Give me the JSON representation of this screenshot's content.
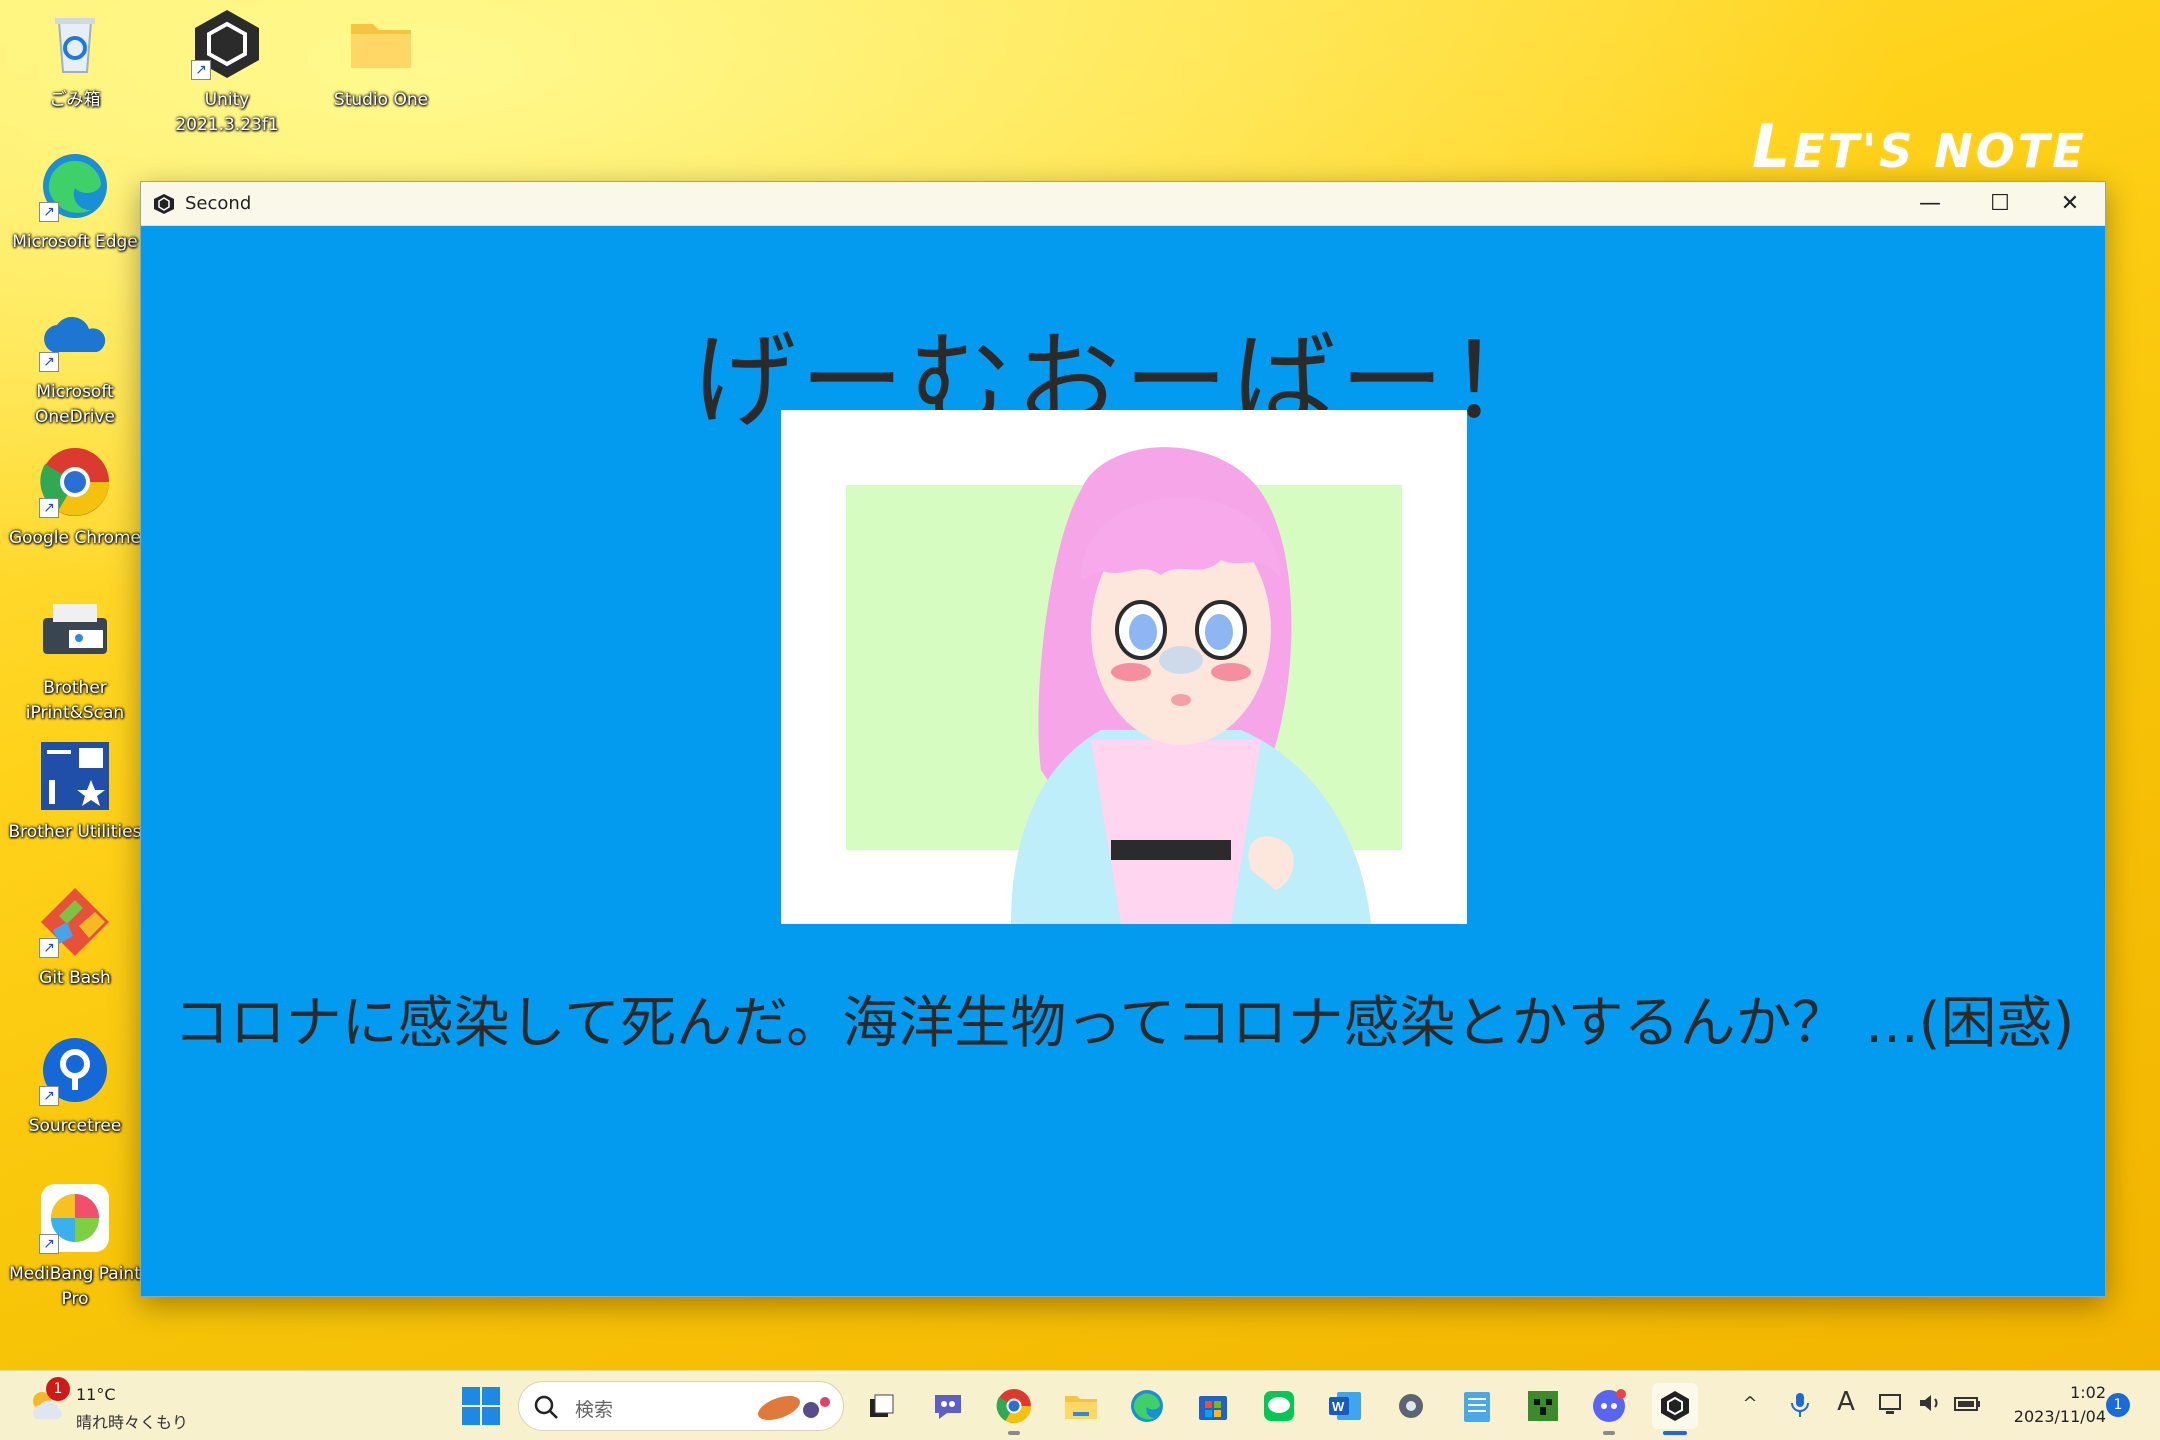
{
  "desktop": {
    "brand": "LET'S NOTE",
    "icons": [
      {
        "label": "ごみ箱"
      },
      {
        "label": "Unity 2021.3.23f1"
      },
      {
        "label": "Studio One"
      },
      {
        "label": "Microsoft Edge"
      },
      {
        "label": "Microsoft OneDrive"
      },
      {
        "label": "Google Chrome"
      },
      {
        "label": "Brother iPrint&Scan"
      },
      {
        "label": "Brother Utilities"
      },
      {
        "label": "Git Bash"
      },
      {
        "label": "Sourcetree"
      },
      {
        "label": "MediBang Paint Pro"
      }
    ]
  },
  "window": {
    "title": "Second",
    "minimize": "—",
    "maximize": "☐",
    "close": "✕"
  },
  "game": {
    "title": "げーむおーばー！",
    "message": "コロナに感染して死んだ。海洋生物ってコロナ感染とかするんか？ ...(困惑)"
  },
  "taskbar": {
    "weather": {
      "temp": "11°C",
      "condition": "晴れ時々くもり",
      "badge": "1"
    },
    "search": {
      "placeholder": "検索"
    },
    "apps": [
      {
        "name": "task-view"
      },
      {
        "name": "chat"
      },
      {
        "name": "google-chrome"
      },
      {
        "name": "file-explorer"
      },
      {
        "name": "microsoft-edge"
      },
      {
        "name": "microsoft-store"
      },
      {
        "name": "line"
      },
      {
        "name": "word"
      },
      {
        "name": "settings"
      },
      {
        "name": "notepad"
      },
      {
        "name": "minecraft"
      },
      {
        "name": "discord"
      },
      {
        "name": "unity"
      }
    ],
    "tray": {
      "chevron": "^",
      "ime": "A"
    },
    "clock": {
      "time": "1:02",
      "date": "2023/11/04"
    },
    "notifications": "1"
  }
}
